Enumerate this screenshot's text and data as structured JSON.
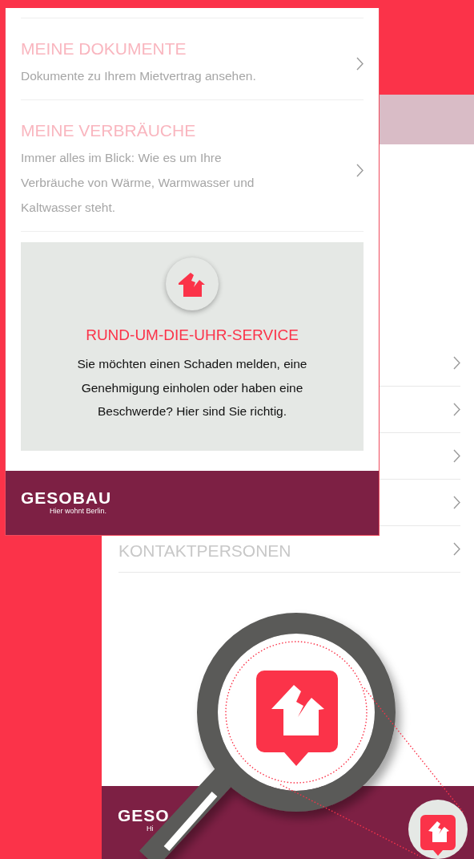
{
  "back_screen": {
    "menu_items": [
      {
        "kind": "chevron"
      },
      {
        "kind": "chevron"
      },
      {
        "kind": "chevron"
      },
      {
        "kind": "chevron"
      },
      {
        "kind": "label",
        "title": "KONTAKTPERSONEN"
      }
    ],
    "footer": {
      "logo": "GESO",
      "tagline": "Hi"
    }
  },
  "front_screen": {
    "menu_items": [
      {
        "title": "MEINE DOKUMENTE",
        "description": "Dokumente zu Ihrem Mietvertrag ansehen."
      },
      {
        "title": "MEINE VERBRÄUCHE",
        "description": "Immer alles im Blick: Wie es um Ihre Verbräuche von Wärme, Warmwasser und Kaltwasser steht."
      }
    ],
    "service_card": {
      "title": "RUND-UM-DIE-UHR-SERVICE",
      "text": "Sie möchten einen Schaden melden, eine Genehmigung einholen oder haben eine Beschwerde? Hier sind Sie richtig."
    },
    "footer": {
      "logo": "GESOBAU",
      "tagline": "Hier wohnt Berlin."
    }
  }
}
